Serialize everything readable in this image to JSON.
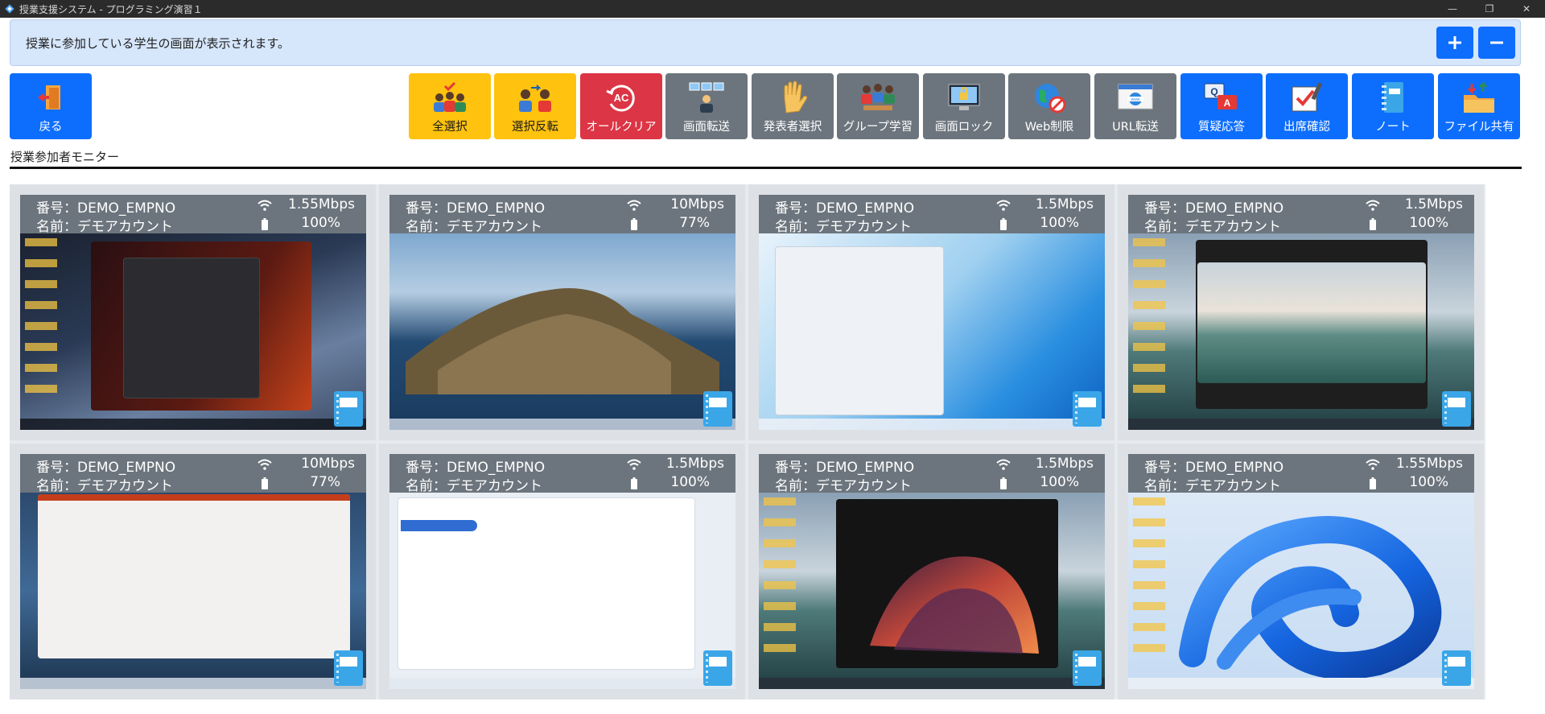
{
  "window": {
    "title": "授業支援システム - プログラミング演習１",
    "minimize": "—",
    "maximize": "❐",
    "close": "✕"
  },
  "info": {
    "message": "授業に参加している学生の画面が表示されます。"
  },
  "toolbar": {
    "back": "戻る",
    "select_all": "全選択",
    "invert_selection": "選択反転",
    "all_clear": "オールクリア",
    "screen_transfer": "画面転送",
    "presenter_select": "発表者選択",
    "group_learning": "グループ学習",
    "screen_lock": "画面ロック",
    "web_restriction": "Web制限",
    "url_transfer": "URL転送",
    "qa": "質疑応答",
    "attendance": "出席確認",
    "notebook": "ノート",
    "file_share": "ファイル共有"
  },
  "section": {
    "title": "授業参加者モニター"
  },
  "students": [
    {
      "id": "番号：DEMO_EMPNO",
      "name": "名前：デモアカウント",
      "speed": "1.55Mbps",
      "battery": "100%",
      "screen": "windows-dark-start"
    },
    {
      "id": "番号：DEMO_EMPNO",
      "name": "名前：デモアカウント",
      "speed": "10Mbps",
      "battery": "77%",
      "screen": "macos-catalina"
    },
    {
      "id": "番号：DEMO_EMPNO",
      "name": "名前：デモアカウント",
      "speed": "1.5Mbps",
      "battery": "100%",
      "screen": "chromeos-launcher"
    },
    {
      "id": "番号：DEMO_EMPNO",
      "name": "名前：デモアカウント",
      "speed": "1.5Mbps",
      "battery": "100%",
      "screen": "windows-lake-photo"
    },
    {
      "id": "番号：DEMO_EMPNO",
      "name": "名前：デモアカウント",
      "speed": "10Mbps",
      "battery": "77%",
      "screen": "macos-powerpoint"
    },
    {
      "id": "番号：DEMO_EMPNO",
      "name": "名前：デモアカウント",
      "speed": "1.5Mbps",
      "battery": "100%",
      "screen": "chromeos-settings"
    },
    {
      "id": "番号：DEMO_EMPNO",
      "name": "名前：デモアカウント",
      "speed": "1.5Mbps",
      "battery": "100%",
      "screen": "windows-dark-wave"
    },
    {
      "id": "番号：DEMO_EMPNO",
      "name": "名前：デモアカウント",
      "speed": "1.55Mbps",
      "battery": "100%",
      "screen": "windows11-bloom"
    }
  ],
  "colors": {
    "accent_blue": "#0d6efd",
    "toolbar_yellow": "#ffc20e",
    "toolbar_red": "#dc3545",
    "toolbar_gray": "#6c757d",
    "card_header": "#6c757d",
    "info_bg": "#d6e6fb"
  }
}
